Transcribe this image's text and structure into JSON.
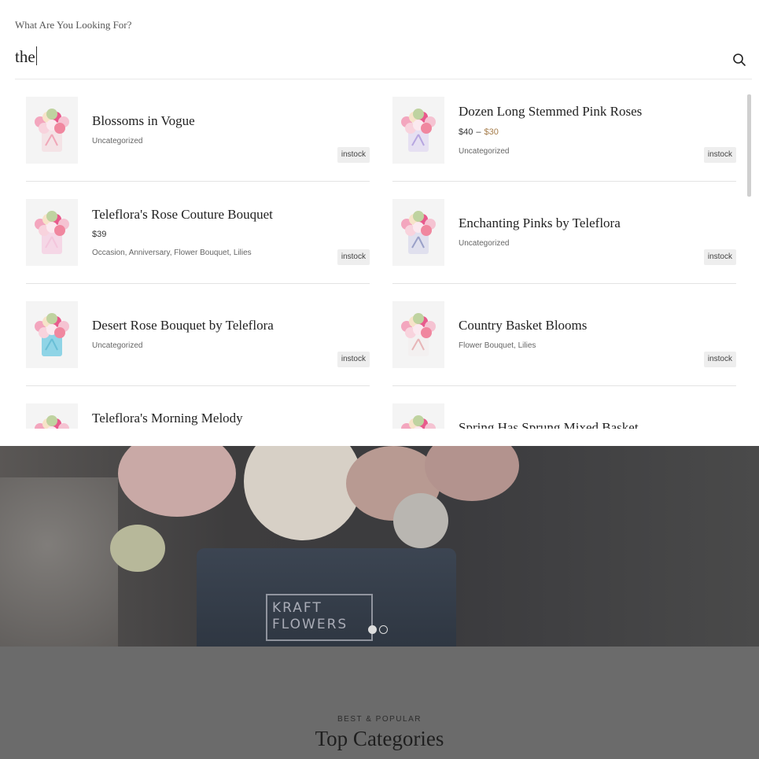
{
  "search": {
    "label": "What Are You Looking For?",
    "value": "the",
    "icon": "search-icon"
  },
  "results": [
    {
      "name": "Blossoms in Vogue",
      "price_low": "",
      "price_high": "",
      "price": "",
      "categories": "Uncategorized",
      "stock": "instock",
      "pot_color": "#f4e3e6",
      "ribbon_color": "#f0a7b8"
    },
    {
      "name": "Dozen Long Stemmed Pink Roses",
      "price_low": "$40",
      "price_high": "$30",
      "price": "",
      "categories": "Uncategorized",
      "stock": "instock",
      "pot_color": "#e6e0f2",
      "ribbon_color": "#b7a6e0"
    },
    {
      "name": "Teleflora's Rose Couture Bouquet",
      "price_low": "",
      "price_high": "",
      "price": "$39",
      "categories": "Occasion, Anniversary, Flower Bouquet, Lilies",
      "stock": "instock",
      "pot_color": "#f5d7e6",
      "ribbon_color": "#f3c6dc"
    },
    {
      "name": "Enchanting Pinks by Teleflora",
      "price_low": "",
      "price_high": "",
      "price": "",
      "categories": "Uncategorized",
      "stock": "instock",
      "pot_color": "#e0e0ee",
      "ribbon_color": "#9aa0c8"
    },
    {
      "name": "Desert Rose Bouquet by Teleflora",
      "price_low": "",
      "price_high": "",
      "price": "",
      "categories": "Uncategorized",
      "stock": "instock",
      "pot_color": "#8fd4e6",
      "ribbon_color": "#69bfd6"
    },
    {
      "name": "Country Basket Blooms",
      "price_low": "",
      "price_high": "",
      "price": "",
      "categories": "Flower Bouquet, Lilies",
      "stock": "instock",
      "pot_color": "#f3f0f0",
      "ribbon_color": "#e7b6b8"
    },
    {
      "name": "Teleflora's Morning Melody",
      "price_low": "",
      "price_high": "",
      "price": "",
      "categories": "",
      "stock": "",
      "pot_color": "#f3e8ea",
      "ribbon_color": "#eab6c0"
    },
    {
      "name": "Spring Has Sprung Mixed Basket",
      "price_low": "",
      "price_high": "",
      "price": "",
      "categories": "",
      "stock": "",
      "pot_color": "#f3e8ea",
      "ribbon_color": "#eab6c0"
    }
  ],
  "background": {
    "hero_logo": "KRAFT\nFLOWERS",
    "category_eyebrow": "BEST & POPULAR",
    "category_title": "Top Categories"
  },
  "colors": {
    "price_accent": "#a57c4a",
    "badge_bg": "#eeeeee",
    "overlay_bg": "#ffffff"
  }
}
